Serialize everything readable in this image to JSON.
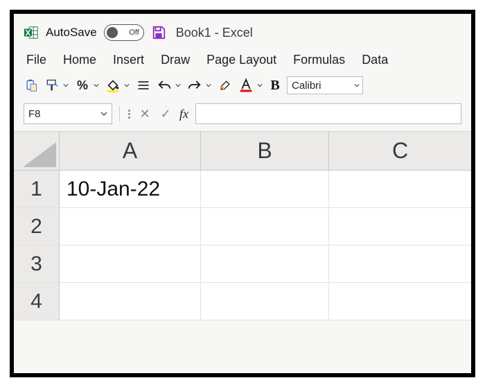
{
  "title_bar": {
    "autosave_label": "AutoSave",
    "autosave_state": "Off",
    "window_title": "Book1  -  Excel"
  },
  "menu": {
    "items": [
      "File",
      "Home",
      "Insert",
      "Draw",
      "Page Layout",
      "Formulas",
      "Data"
    ]
  },
  "toolbar": {
    "font_name": "Calibri",
    "bold_label": "B"
  },
  "formula_bar": {
    "name_box": "F8",
    "fx_label": "fx",
    "formula_value": ""
  },
  "grid": {
    "columns": [
      "A",
      "B",
      "C"
    ],
    "rows": [
      "1",
      "2",
      "3",
      "4"
    ],
    "cells": {
      "A1": "10-Jan-22",
      "B1": "",
      "C1": "",
      "A2": "",
      "B2": "",
      "C2": "",
      "A3": "",
      "B3": "",
      "C3": "",
      "A4": "",
      "B4": "",
      "C4": ""
    }
  }
}
